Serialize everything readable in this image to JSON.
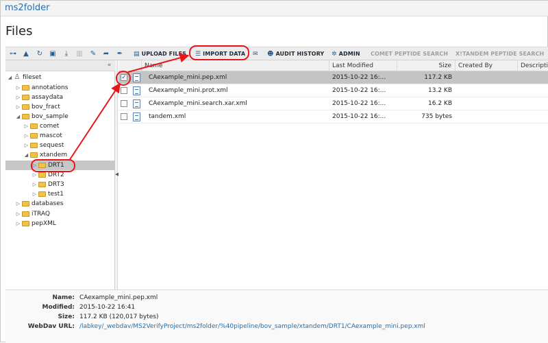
{
  "header": {
    "folder": "ms2folder"
  },
  "page_title": "Files",
  "toolbar": {
    "icons": [
      "sitemap-icon",
      "up-arrow-icon",
      "refresh-icon",
      "new-folder-icon",
      "download-icon",
      "delete-icon",
      "edit-icon",
      "move-icon",
      "wrench-icon"
    ],
    "upload_label": "UPLOAD FILES",
    "import_label": "IMPORT DATA",
    "email_icon": "envelope-icon",
    "audit_label": "AUDIT HISTORY",
    "admin_label": "ADMIN",
    "comet_label": "COMET PEPTIDE SEARCH",
    "xtandem_label": "X!TANDEM PEPTIDE SEARCH"
  },
  "tree": {
    "collapse": "«",
    "root": "fileset",
    "nodes": {
      "annotations": "annotations",
      "assaydata": "assaydata",
      "bov_fract": "bov_fract",
      "bov_sample": "bov_sample",
      "comet": "comet",
      "mascot": "mascot",
      "sequest": "sequest",
      "xtandem": "xtandem",
      "DRT1": "DRT1",
      "DRT2": "DRT2",
      "DRT3": "DRT3",
      "test1": "test1",
      "databases": "databases",
      "iTRAQ": "iTRAQ",
      "pepXML": "pepXML"
    }
  },
  "grid": {
    "columns": {
      "name": "Name",
      "last_modified": "Last Modified",
      "size": "Size",
      "created_by": "Created By",
      "description": "Descripti"
    },
    "rows": [
      {
        "name": "CAexample_mini.pep.xml",
        "modified": "2015-10-22 16:...",
        "size": "117.2 KB",
        "selected": true
      },
      {
        "name": "CAexample_mini.prot.xml",
        "modified": "2015-10-22 16:...",
        "size": "13.2 KB",
        "selected": false
      },
      {
        "name": "CAexample_mini.search.xar.xml",
        "modified": "2015-10-22 16:...",
        "size": "16.2 KB",
        "selected": false
      },
      {
        "name": "tandem.xml",
        "modified": "2015-10-22 16:...",
        "size": "735 bytes",
        "selected": false
      }
    ]
  },
  "details": {
    "name_label": "Name:",
    "name_value": "CAexample_mini.pep.xml",
    "modified_label": "Modified:",
    "modified_value": "2015-10-22 16:41",
    "size_label": "Size:",
    "size_value": "117.2 KB (120,017 bytes)",
    "webdav_label": "WebDav URL:",
    "webdav_value": "/labkey/_webdav/MS2VerifyProject/ms2folder/%40pipeline/bov_sample/xtandem/DRT1/CAexample_mini.pep.xml"
  },
  "colors": {
    "annotation": "#e8151b",
    "link": "#1f6fb2",
    "selection": "#c4c4c4",
    "folder": "#f0c24a"
  }
}
